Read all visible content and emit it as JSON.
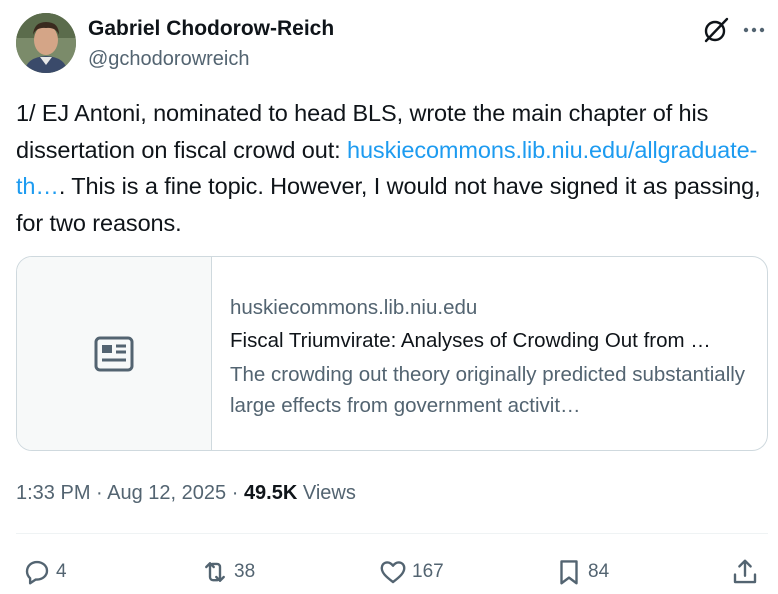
{
  "author": {
    "display_name": "Gabriel Chodorow-Reich",
    "handle": "@gchodorowreich"
  },
  "tweet": {
    "text_before": "1/ EJ Antoni, nominated to head BLS, wrote the main chapter of his dissertation on fiscal crowd out: ",
    "link_text": "huskiecommons.lib.niu.edu/allgraduate-th…",
    "text_after": ". This is a fine topic. However, I would not have signed it as passing, for two reasons."
  },
  "card": {
    "domain": "huskiecommons.lib.niu.edu",
    "title": "Fiscal Triumvirate: Analyses of Crowding Out from …",
    "description": "The crowding out theory originally predicted substantially large effects from government activit…",
    "thumbnail_icon": "article-icon"
  },
  "meta": {
    "time": "1:33 PM",
    "sep1": " · ",
    "date": "Aug 12, 2025",
    "sep2": " · ",
    "views_count": "49.5K",
    "views_label": " Views"
  },
  "actions": {
    "replies": "4",
    "reposts": "38",
    "likes": "167",
    "bookmarks": "84"
  },
  "colors": {
    "text": "#0f1419",
    "secondary": "#536471",
    "link": "#1d9bf0",
    "border": "#cfd9de"
  }
}
